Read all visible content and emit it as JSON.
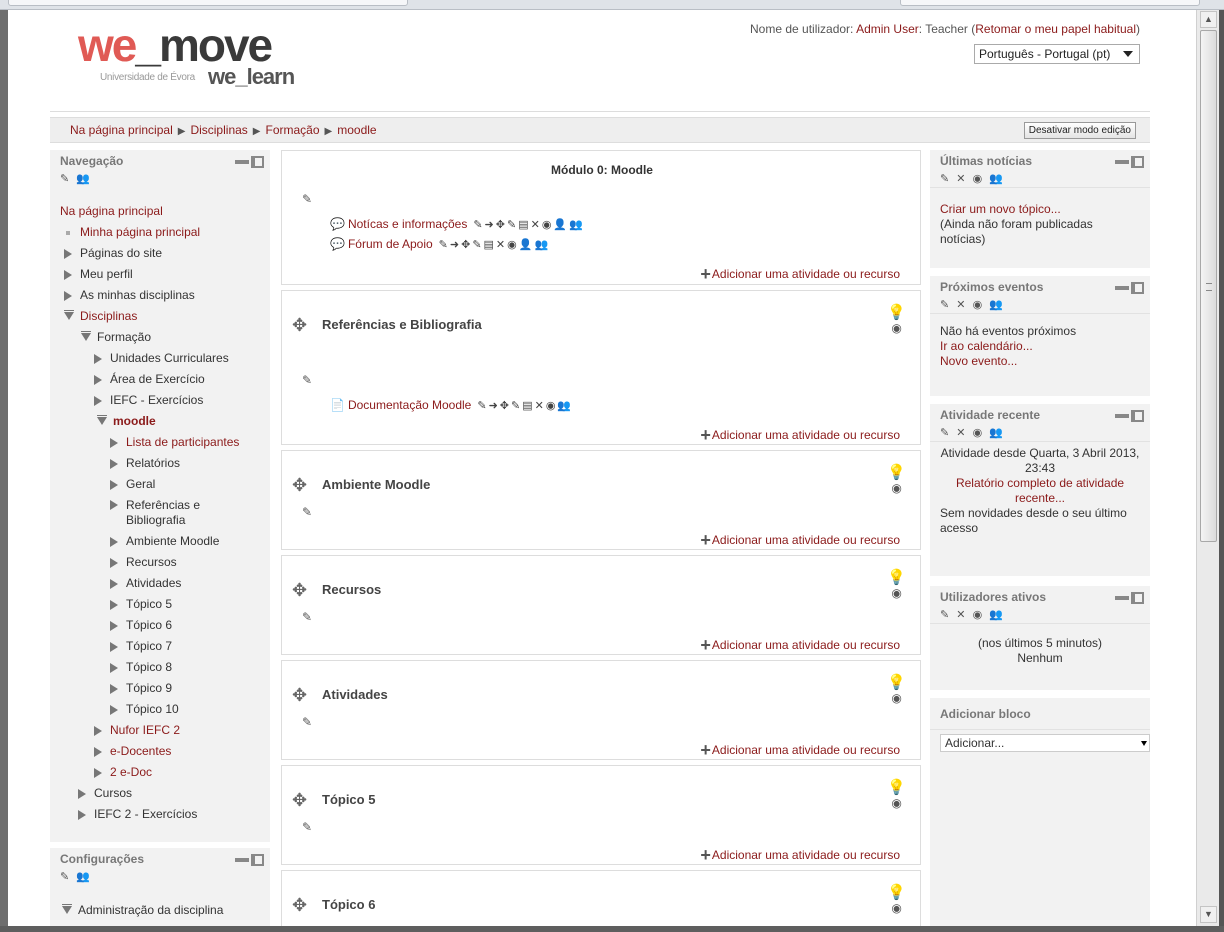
{
  "header": {
    "logo_we": "we",
    "logo_move": "_move",
    "logo_university": "Universidade de Évora",
    "logo_learn": "we_learn",
    "login_prefix": "Nome de utilizador: ",
    "login_user": "Admin User",
    "login_role": ": Teacher (",
    "login_return": "Retomar o meu papel habitual",
    "login_suffix": ")",
    "language": "Português - Portugal (pt)"
  },
  "breadcrumb": {
    "items": [
      "Na página principal",
      "Disciplinas",
      "Formação",
      "moodle"
    ],
    "separator": "▶",
    "edit_button": "Desativar modo edição"
  },
  "navigation": {
    "title": "Navegação",
    "home": "Na página principal",
    "my_home": "Minha página principal",
    "site_pages": "Páginas do site",
    "my_profile": "Meu perfil",
    "my_courses": "As minhas disciplinas",
    "courses": "Disciplinas",
    "formacao": "Formação",
    "units": "Unidades Curriculares",
    "exercise": "Área de Exercício",
    "iefc": "IEFC - Exercícios",
    "moodle": "moodle",
    "participants": "Lista de participantes",
    "reports": "Relatórios",
    "general": "Geral",
    "refs1": "Referências e",
    "refs2": "Bibliografia",
    "env": "Ambiente Moodle",
    "resources": "Recursos",
    "activities": "Atividades",
    "t5": "Tópico 5",
    "t6": "Tópico 6",
    "t7": "Tópico 7",
    "t8": "Tópico 8",
    "t9": "Tópico 9",
    "t10": "Tópico 10",
    "nufor": "Nufor IEFC 2",
    "edocentes": "e-Docentes",
    "edoc2": "2 e-Doc",
    "cursos": "Cursos",
    "iefc2": "IEFC 2 - Exercícios"
  },
  "settings": {
    "title": "Configurações",
    "admin": "Administração da disciplina"
  },
  "sections": {
    "s0_title": "Módulo 0: Moodle",
    "s0_act1": "Notícas e informações",
    "s0_act2": "Fórum de Apoio",
    "s1_title": "Referências e Bibliografia",
    "s1_act1": "Documentação Moodle",
    "s2_title": "Ambiente Moodle",
    "s3_title": "Recursos",
    "s4_title": "Atividades",
    "s5_title": "Tópico 5",
    "s6_title": "Tópico 6",
    "add_activity": "Adicionar uma atividade ou recurso"
  },
  "news": {
    "title": "Últimas notícias",
    "new_topic": "Criar um novo tópico...",
    "none": "(Ainda não foram publicadas notícias)"
  },
  "events": {
    "title": "Próximos eventos",
    "none": "Não há eventos próximos",
    "calendar": "Ir ao calendário...",
    "new_event": "Novo evento..."
  },
  "recent": {
    "title": "Atividade recente",
    "since": "Atividade desde Quarta, 3 Abril 2013, 23:43",
    "report": "Relatório completo de atividade recente...",
    "nothing": "Sem novidades desde o seu último acesso"
  },
  "online": {
    "title": "Utilizadores ativos",
    "period": "(nos últimos 5 minutos)",
    "none": "Nenhum"
  },
  "add_block": {
    "title": "Adicionar bloco",
    "select": "Adicionar..."
  },
  "icons": {
    "edit": "edit-icon",
    "move": "move-icon",
    "hide": "eye-icon",
    "highlight": "lightbulb-icon",
    "forum": "speech-bubble-icon",
    "document": "document-icon"
  },
  "colors": {
    "link": "#8b1a1a",
    "block_bg": "#f2f2f2",
    "logo_red": "#e05a55"
  }
}
